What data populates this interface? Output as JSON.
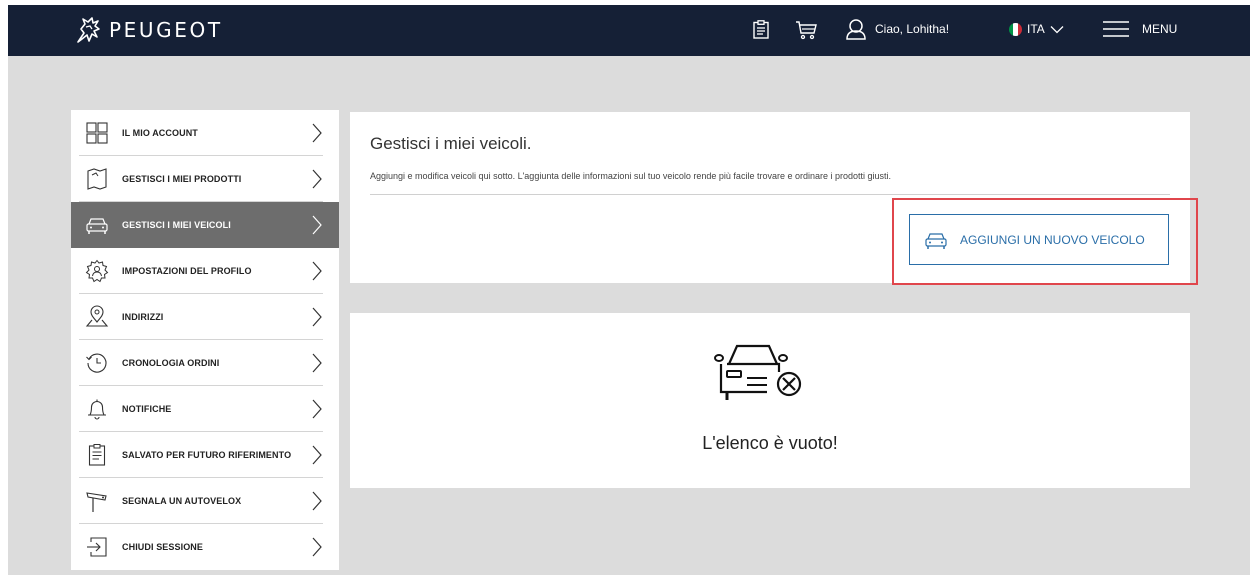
{
  "header": {
    "brand": "PEUGEOT",
    "greeting": "Ciao, Lohitha!",
    "language": "ITA",
    "menu_label": "MENU",
    "icons": [
      "clipboard-icon",
      "cart-icon",
      "user-icon",
      "italy-flag-icon",
      "hamburger-icon"
    ],
    "background_color": "#152036"
  },
  "sidebar": {
    "items": [
      {
        "label": "IL MIO ACCOUNT",
        "icon": "grid-icon",
        "active": false
      },
      {
        "label": "GESTISCI I MIEI PRODOTTI",
        "icon": "map-product-icon",
        "active": false
      },
      {
        "label": "GESTISCI I MIEI VEICOLI",
        "icon": "car-icon",
        "active": true
      },
      {
        "label": "IMPOSTAZIONI DEL PROFILO",
        "icon": "profile-gear-icon",
        "active": false
      },
      {
        "label": "INDIRIZZI",
        "icon": "location-pin-icon",
        "active": false
      },
      {
        "label": "CRONOLOGIA ORDINI",
        "icon": "history-clock-icon",
        "active": false
      },
      {
        "label": "NOTIFICHE",
        "icon": "bell-icon",
        "active": false
      },
      {
        "label": "SALVATO PER FUTURO RIFERIMENTO",
        "icon": "clipboard-icon",
        "active": false
      },
      {
        "label": "SEGNALA UN AUTOVELOX",
        "icon": "speed-camera-icon",
        "active": false
      },
      {
        "label": "CHIUDI SESSIONE",
        "icon": "logout-icon",
        "active": false
      }
    ],
    "active_color": "#6d6d6d"
  },
  "vehicles": {
    "title": "Gestisci i miei veicoli.",
    "description": "Aggiungi e modifica veicoli qui sotto. L'aggiunta delle informazioni sul tuo veicolo rende più facile trovare e ordinare i prodotti giusti.",
    "add_button_label": "AGGIUNGI UN NUOVO VEICOLO",
    "accent_color": "#2a6ea8",
    "highlight_color": "#e0464c"
  },
  "empty_state": {
    "message": "L'elenco è vuoto!",
    "icon": "car-removed-icon"
  }
}
